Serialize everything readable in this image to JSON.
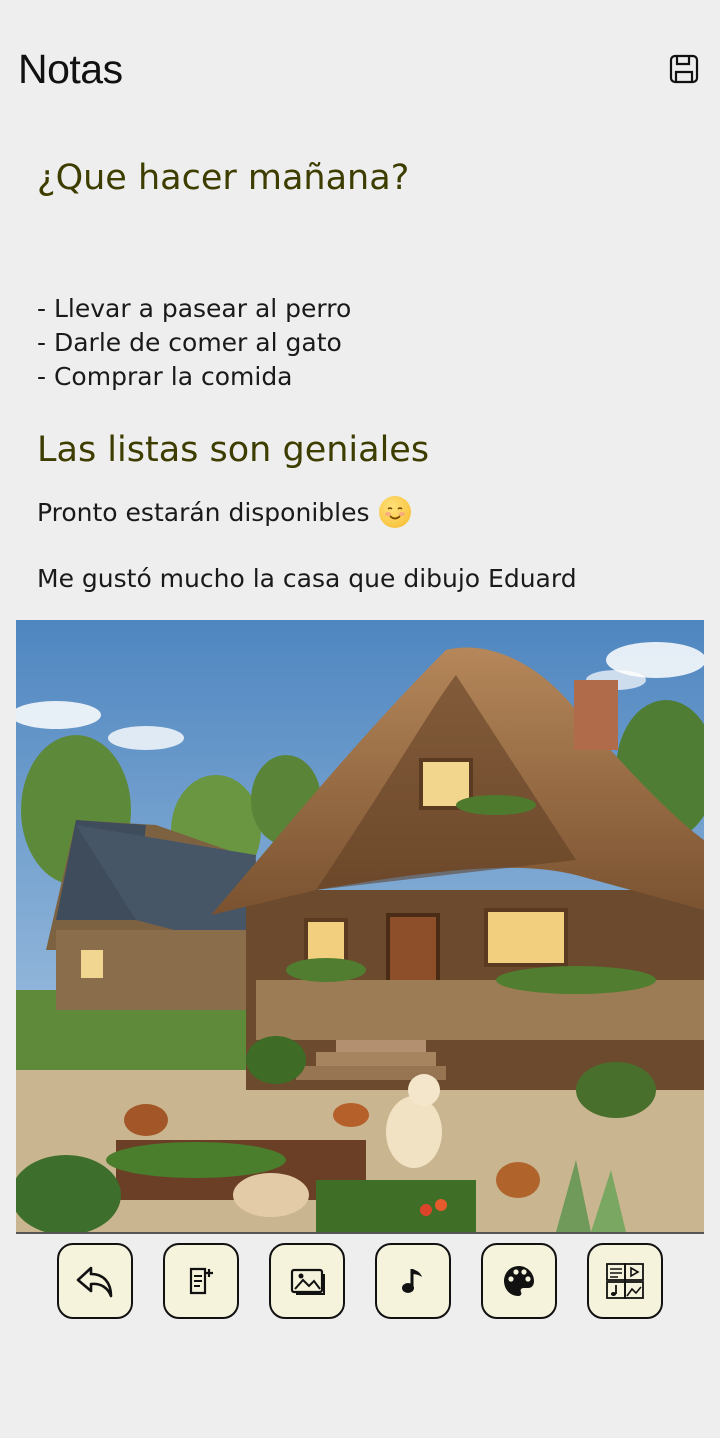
{
  "header": {
    "title": "Notas",
    "save_icon": "save-icon"
  },
  "note": {
    "title": "¿Que hacer mañana?",
    "list": [
      "- Llevar a pasear al perro",
      "- Darle de comer al gato",
      "- Comprar la comida"
    ],
    "section_title": "Las listas son geniales",
    "paragraph1": "Pronto estarán disponibles",
    "paragraph1_emoji": "smiling-face-emoji",
    "paragraph2": "Me gustó mucho la casa que dibujo Eduard",
    "image": "thatched-house-garden-illustration"
  },
  "toolbar": {
    "buttons": [
      {
        "name": "undo",
        "icon": "undo-icon"
      },
      {
        "name": "add-text",
        "icon": "add-note-icon"
      },
      {
        "name": "add-image",
        "icon": "image-icon"
      },
      {
        "name": "add-audio",
        "icon": "music-note-icon"
      },
      {
        "name": "theme",
        "icon": "palette-icon"
      },
      {
        "name": "media",
        "icon": "media-icon"
      }
    ]
  },
  "colors": {
    "accent": "#3d3d00",
    "button_bg": "#f5f3dc",
    "background": "#eeeeee"
  }
}
